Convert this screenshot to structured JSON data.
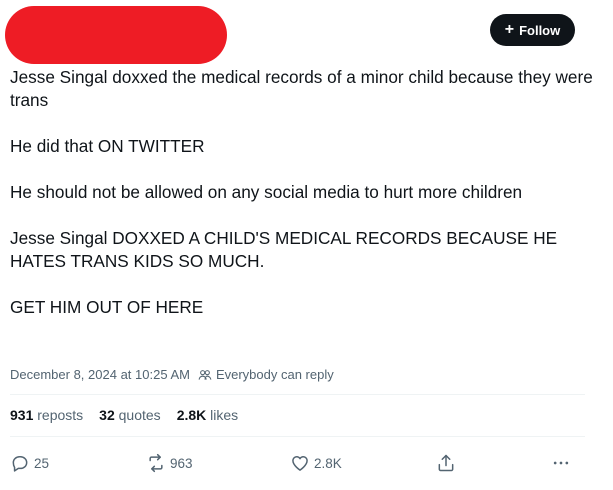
{
  "header": {
    "follow_label": "Follow"
  },
  "tweet": {
    "paragraphs": [
      "Jesse Singal doxxed the medical records of a minor child because they were trans",
      "He did that ON TWITTER",
      "He should not be allowed on any social media to hurt more children",
      "Jesse Singal DOXXED A CHILD'S MEDICAL RECORDS BECAUSE HE HATES TRANS KIDS SO MUCH.",
      "GET HIM OUT OF HERE"
    ],
    "timestamp": "December 8, 2024 at 10:25 AM",
    "reply_permission": "Everybody can reply"
  },
  "stats": {
    "reposts_count": "931",
    "reposts_label": "reposts",
    "quotes_count": "32",
    "quotes_label": "quotes",
    "likes_count": "2.8K",
    "likes_label": "likes"
  },
  "actions": {
    "replies": "25",
    "reposts": "963",
    "likes": "2.8K",
    "icons": [
      "reply-icon",
      "repost-icon",
      "like-icon",
      "share-icon",
      "more-icon"
    ]
  },
  "colors": {
    "redaction": "#ee1c25",
    "text": "#0f1419",
    "muted": "#536471",
    "follow_bg": "#0f1419"
  }
}
